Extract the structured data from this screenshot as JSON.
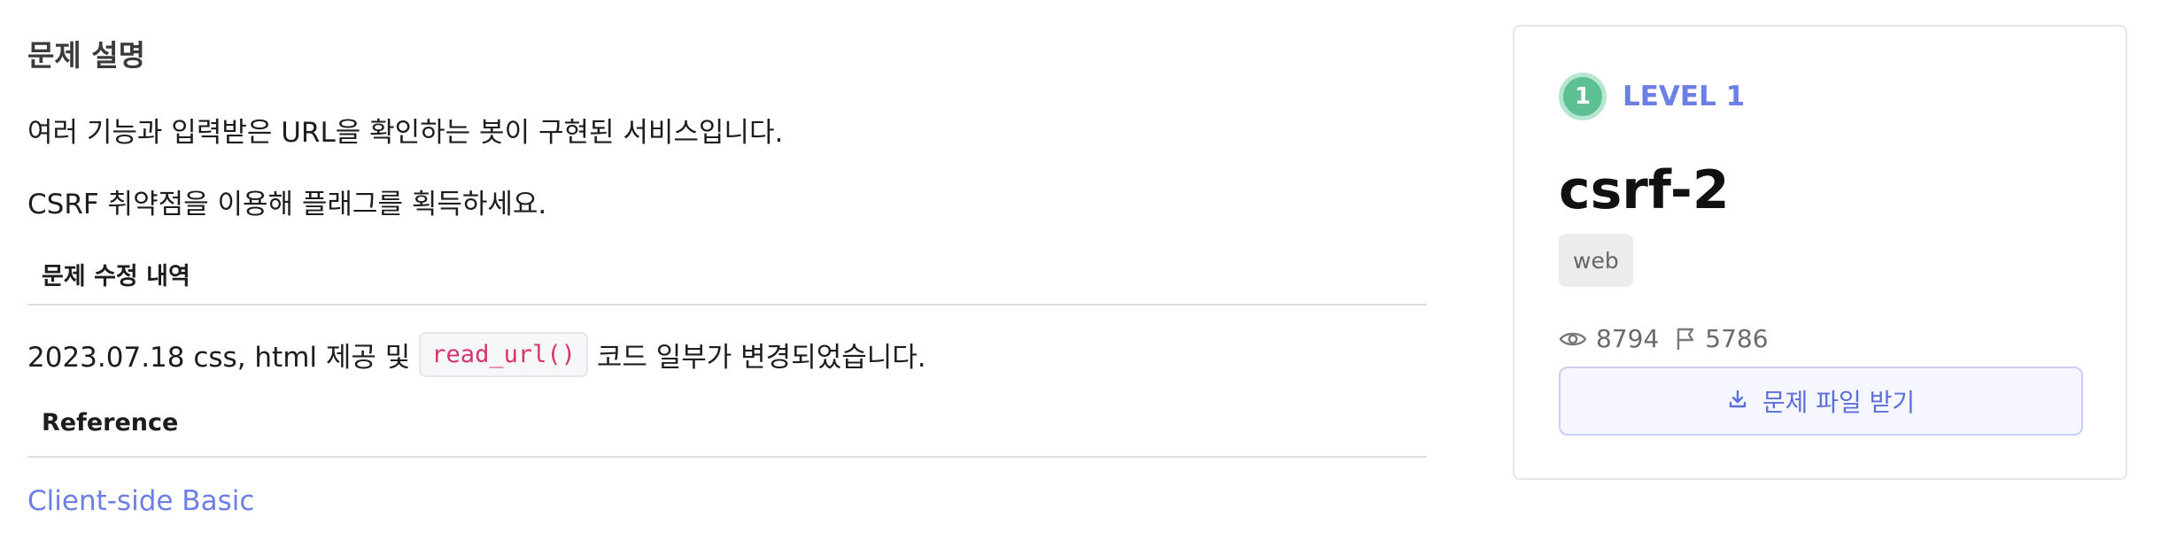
{
  "description": {
    "heading": "문제 설명",
    "line1": "여러 기능과 입력받은 URL을 확인하는 봇이 구현된 서비스입니다.",
    "line2": "CSRF 취약점을 이용해 플래그를 획득하세요.",
    "revision_heading": "문제 수정 내역",
    "revision_prefix": "2023.07.18 css, html 제공 및",
    "revision_code": "read_url()",
    "revision_suffix": "코드 일부가 변경되었습니다.",
    "reference_heading": "Reference",
    "reference_link": "Client-side Basic"
  },
  "card": {
    "level_number": "1",
    "level_label": "LEVEL 1",
    "title": "csrf-2",
    "tag": "web",
    "views": "8794",
    "solves": "5786",
    "download_label": "문제 파일 받기"
  },
  "icons": {
    "views": "eye-icon",
    "solves": "flag-icon",
    "download": "download-icon"
  },
  "colors": {
    "accent": "#6c7fe6",
    "level_badge": "#5cc094",
    "code_text": "#d6336c"
  }
}
